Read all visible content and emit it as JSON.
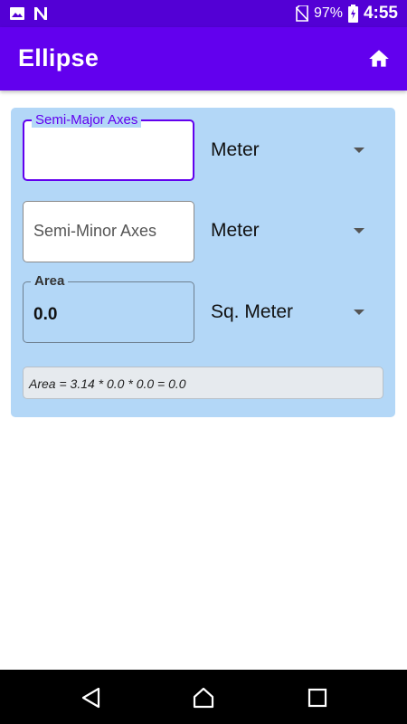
{
  "status_bar": {
    "battery": "97%",
    "time": "4:55",
    "icons": [
      "image-icon",
      "n-notification-icon",
      "no-sim-icon",
      "battery-charging-icon"
    ]
  },
  "app_bar": {
    "title": "Ellipse",
    "home_icon": "home-icon"
  },
  "form": {
    "semi_major": {
      "label": "Semi-Major Axes",
      "value": "",
      "unit": "Meter"
    },
    "semi_minor": {
      "placeholder": "Semi-Minor Axes",
      "value": "",
      "unit": "Meter"
    },
    "area": {
      "label": "Area",
      "value": "0.0",
      "unit": "Sq. Meter"
    },
    "formula": "Area = 3.14 * 0.0 * 0.0 = 0.0"
  },
  "colors": {
    "status_bar": "#5300d5",
    "app_bar": "#6200ee",
    "card": "#b3d7f7",
    "accent": "#6200ee"
  },
  "nav_bar": {
    "icons": [
      "back-icon",
      "home-icon",
      "recents-icon"
    ]
  }
}
